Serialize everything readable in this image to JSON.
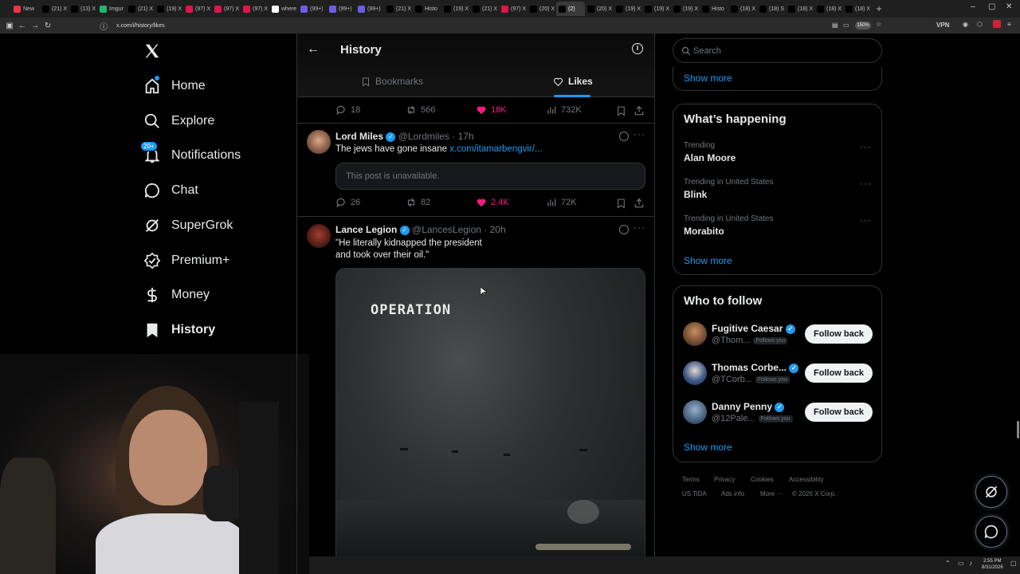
{
  "browser": {
    "tabs": [
      {
        "label": "New",
        "fav": "#e34",
        "active": false
      },
      {
        "label": "(21) X",
        "fav": "#000",
        "active": false
      },
      {
        "label": "(13) X",
        "fav": "#000",
        "active": false
      },
      {
        "label": "Imgur",
        "fav": "#1bb76e",
        "active": false
      },
      {
        "label": "(21) X",
        "fav": "#000",
        "active": false
      },
      {
        "label": "(19) X",
        "fav": "#000",
        "active": false
      },
      {
        "label": "(97) X",
        "fav": "#e0144c",
        "active": false
      },
      {
        "label": "(97) X",
        "fav": "#e0144c",
        "active": false
      },
      {
        "label": "(97) X",
        "fav": "#e0144c",
        "active": false
      },
      {
        "label": "where",
        "fav": "#fff",
        "active": false
      },
      {
        "label": "(99+)",
        "fav": "#6c5ce7",
        "active": false
      },
      {
        "label": "(99+)",
        "fav": "#6c5ce7",
        "active": false
      },
      {
        "label": "(99+)",
        "fav": "#6c5ce7",
        "active": false
      },
      {
        "label": "(21) X",
        "fav": "#000",
        "active": false
      },
      {
        "label": "Histo",
        "fav": "#000",
        "active": false
      },
      {
        "label": "(19) X",
        "fav": "#000",
        "active": false
      },
      {
        "label": "(21) X",
        "fav": "#000",
        "active": false
      },
      {
        "label": "(97) X",
        "fav": "#e0144c",
        "active": false
      },
      {
        "label": "(20) X",
        "fav": "#000",
        "active": false
      },
      {
        "label": "(2)",
        "fav": "#000",
        "active": true
      },
      {
        "label": "(20) X",
        "fav": "#000",
        "active": false
      },
      {
        "label": "(19) X",
        "fav": "#000",
        "active": false
      },
      {
        "label": "(19) X",
        "fav": "#000",
        "active": false
      },
      {
        "label": "(19) X",
        "fav": "#000",
        "active": false
      },
      {
        "label": "Histo",
        "fav": "#000",
        "active": false
      },
      {
        "label": "(18) X",
        "fav": "#000",
        "active": false
      },
      {
        "label": "(18) S",
        "fav": "#000",
        "active": false
      },
      {
        "label": "(18) X",
        "fav": "#000",
        "active": false
      },
      {
        "label": "(18) X",
        "fav": "#000",
        "active": false
      },
      {
        "label": "(18) X",
        "fav": "#000",
        "active": false
      }
    ],
    "url": "x.com/i/history/likes",
    "zoom": "150%",
    "vpn": "VPN"
  },
  "nav": {
    "home": "Home",
    "explore": "Explore",
    "notifications": "Notifications",
    "notif_badge": "20+",
    "chat": "Chat",
    "supergrok": "SuperGrok",
    "premium": "Premium+",
    "money": "Money",
    "history": "History"
  },
  "header": {
    "title": "History",
    "tab_bookmarks": "Bookmarks",
    "tab_likes": "Likes"
  },
  "posts": [
    {
      "replies": "18",
      "reposts": "566",
      "likes": "18K",
      "views": "732K"
    },
    {
      "name": "Lord Miles",
      "handle": "@Lordmiles",
      "time": "· 17h",
      "text": "The jews have gone insane ",
      "link": "x.com/itamarbengvir/...",
      "quote_unavailable": "This post is unavailable.",
      "replies": "26",
      "reposts": "82",
      "likes": "2.4K",
      "views": "72K"
    },
    {
      "name": "Lance Legion",
      "handle": "@LancesLegion",
      "time": "· 20h",
      "text_line1": "\"He literally kidnapped the president",
      "text_line2": "and took over their oil.\"",
      "media_text": "OPERATION"
    }
  ],
  "sidebar": {
    "search_placeholder": "Search",
    "show_more": "Show more",
    "whats_happening": "What’s happening",
    "trends": [
      {
        "meta": "Trending",
        "name": "Alan Moore"
      },
      {
        "meta": "Trending in United States",
        "name": "Blink"
      },
      {
        "meta": "Trending in United States",
        "name": "Morabito"
      }
    ],
    "who_to_follow": "Who to follow",
    "follow": [
      {
        "name": "Fugitive Caesar",
        "handle": "@Thom...",
        "badge": "Follows you",
        "button": "Follow back"
      },
      {
        "name": "Thomas Corbe...",
        "handle": "@TCorb...",
        "badge": "Follows you",
        "button": "Follow back"
      },
      {
        "name": "Danny Penny",
        "handle": "@12Pale...",
        "badge": "Follows you",
        "button": "Follow back"
      }
    ],
    "footer": {
      "terms": "Terms",
      "privacy": "Privacy",
      "cookies": "Cookies",
      "accessibility": "Accessibility",
      "ads": "US TiDA",
      "ads_info": "Ads info",
      "more": "More ···",
      "copyright": "© 2026 X Corp."
    }
  },
  "taskbar": {
    "time": "2:55 PM",
    "date": "8/31/2026"
  }
}
